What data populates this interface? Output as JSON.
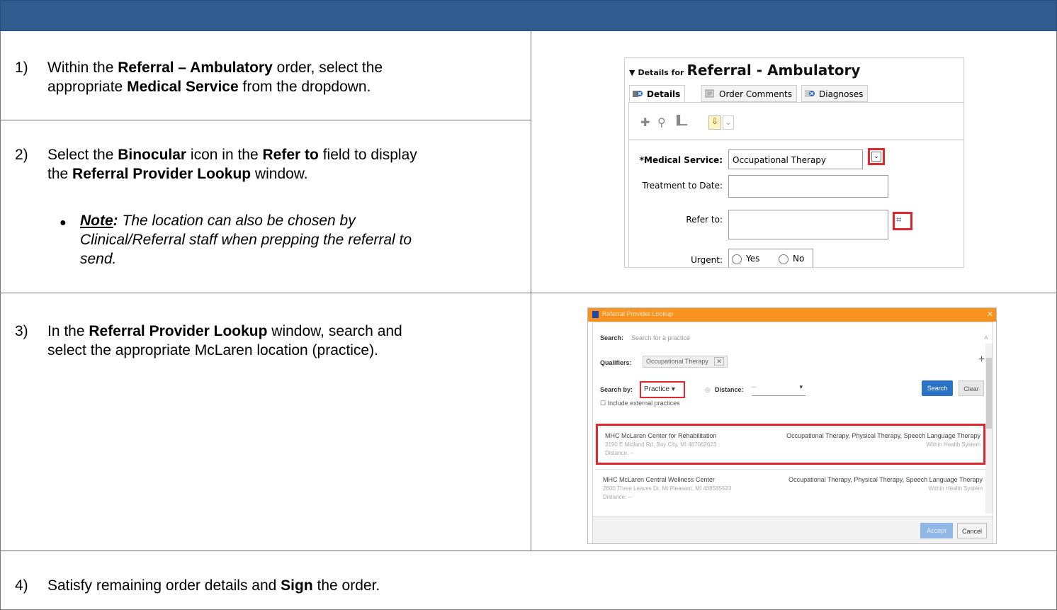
{
  "steps": [
    {
      "num": "1)",
      "line1": {
        "pre": "Within the ",
        "b1": "Referral – Ambulatory",
        "post": " order, select the"
      },
      "line2": {
        "pre": "appropriate ",
        "b1": "Medical Service",
        "post": " from the dropdown."
      }
    },
    {
      "num": "2)",
      "line1": {
        "pre": "Select the ",
        "b1": "Binocular",
        "mid": " icon in the ",
        "b2": "Refer to",
        "post": " field to display"
      },
      "line2": {
        "pre": "the ",
        "b1": "Referral Provider Lookup",
        "post": " window."
      },
      "note": {
        "label": "Note",
        "colon": ":",
        "line1": " The location can also be chosen by",
        "line2": "Clinical/Referral staff when prepping the referral to",
        "line3": "send."
      }
    },
    {
      "num": "3)",
      "line1": {
        "pre": "In the ",
        "b1": "Referral Provider Lookup",
        "post": " window, search and"
      },
      "line2": {
        "pre": "select the appropriate McLaren location (practice)."
      }
    },
    {
      "num": "4)",
      "line1": {
        "pre": "Satisfy remaining order details and ",
        "b1": "Sign",
        "post": " the order."
      }
    }
  ],
  "details_shot": {
    "title_prefix": "Details for",
    "title": "Referral - Ambulatory",
    "tabs": [
      "Details",
      "Order Comments",
      "Diagnoses"
    ],
    "fields": {
      "medical_service_label": "*Medical Service:",
      "medical_service_value": "Occupational Therapy",
      "treatment_label": "Treatment to Date:",
      "refer_to_label": "Refer to:",
      "urgent_label": "Urgent:",
      "urgent_yes": "Yes",
      "urgent_no": "No"
    }
  },
  "lookup_shot": {
    "window_title": "Referral Provider Lookup",
    "search_label": "Search:",
    "search_placeholder": "Search for a practice",
    "qualifiers_label": "Qualifiers:",
    "qualifier_chip": "Occupational Therapy",
    "search_by_label": "Search by:",
    "search_by_value": "Practice",
    "distance_label": "Distance:",
    "distance_value": "--",
    "include_external": "Include external practices",
    "search_button": "Search",
    "clear_button": "Clear",
    "results": [
      {
        "name": "MHC McLaren Center for Rehabilitation",
        "address": "3190 E Midland Rd, Bay City, MI 487062623",
        "distance": "Distance: --",
        "specialties": "Occupational Therapy, Physical Therapy, Speech Language Therapy",
        "system": "Within Health System"
      },
      {
        "name": "MHC McLaren Central Wellness Center",
        "address": "2600 Three Leaves Dr, Mt Pleasant, MI 488585523",
        "distance": "Distance: --",
        "specialties": "Occupational Therapy, Physical Therapy, Speech Language Therapy",
        "system": "Within Health System"
      }
    ],
    "accept_button": "Accept",
    "cancel_button": "Cancel"
  }
}
